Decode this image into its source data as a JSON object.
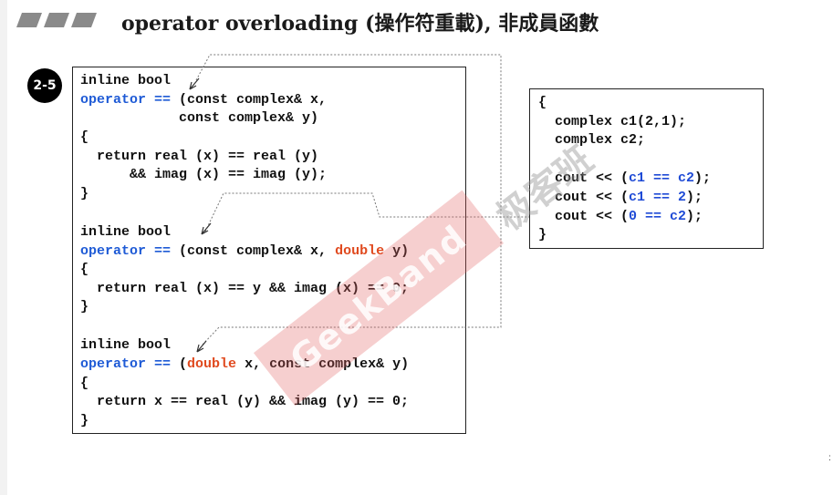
{
  "slide": {
    "title": "operator overloading (操作符重載), 非成員函數",
    "badge": "2-5"
  },
  "code_left": {
    "block1": {
      "decl": "inline bool",
      "op_kw": "operator ==",
      "params1": " (const complex& x,",
      "params2": "            const complex& y)",
      "open": "{",
      "body1": "  return real (x) == real (y)",
      "body2": "      && imag (x) == imag (y);",
      "close": "}"
    },
    "block2": {
      "decl": "inline bool",
      "op_kw": "operator ==",
      "params_a": " (const complex& x, ",
      "params_hl": "double",
      "params_b": " y)",
      "open": "{",
      "body1": "  return real (x) == y && imag (x) == 0;",
      "close": "}"
    },
    "block3": {
      "decl": "inline bool",
      "op_kw": "operator ==",
      "params_a": " (",
      "params_hl": "double",
      "params_b": " x, const complex& y)",
      "open": "{",
      "body1": "  return x == real (y) && imag (y) == 0;",
      "close": "}"
    }
  },
  "code_right": {
    "open": "{",
    "line1": "  complex c1(2,1);",
    "line2": "  complex c2;",
    "cout1_a": "  cout << (",
    "cout1_b": "c1 == c2",
    "cout1_c": ");",
    "cout2_a": "  cout << (",
    "cout2_b": "c1 == 2",
    "cout2_c": ");",
    "cout3_a": "  cout << (",
    "cout3_b": "0 == c2",
    "cout3_c": ");",
    "close": "}"
  },
  "watermark": {
    "text": "GeekBand",
    "cn": "极客班"
  },
  "page_mark": ":",
  "colors": {
    "keyword": "#1f5bd6",
    "highlight": "#e04a1f",
    "watermark": "#e26060"
  }
}
